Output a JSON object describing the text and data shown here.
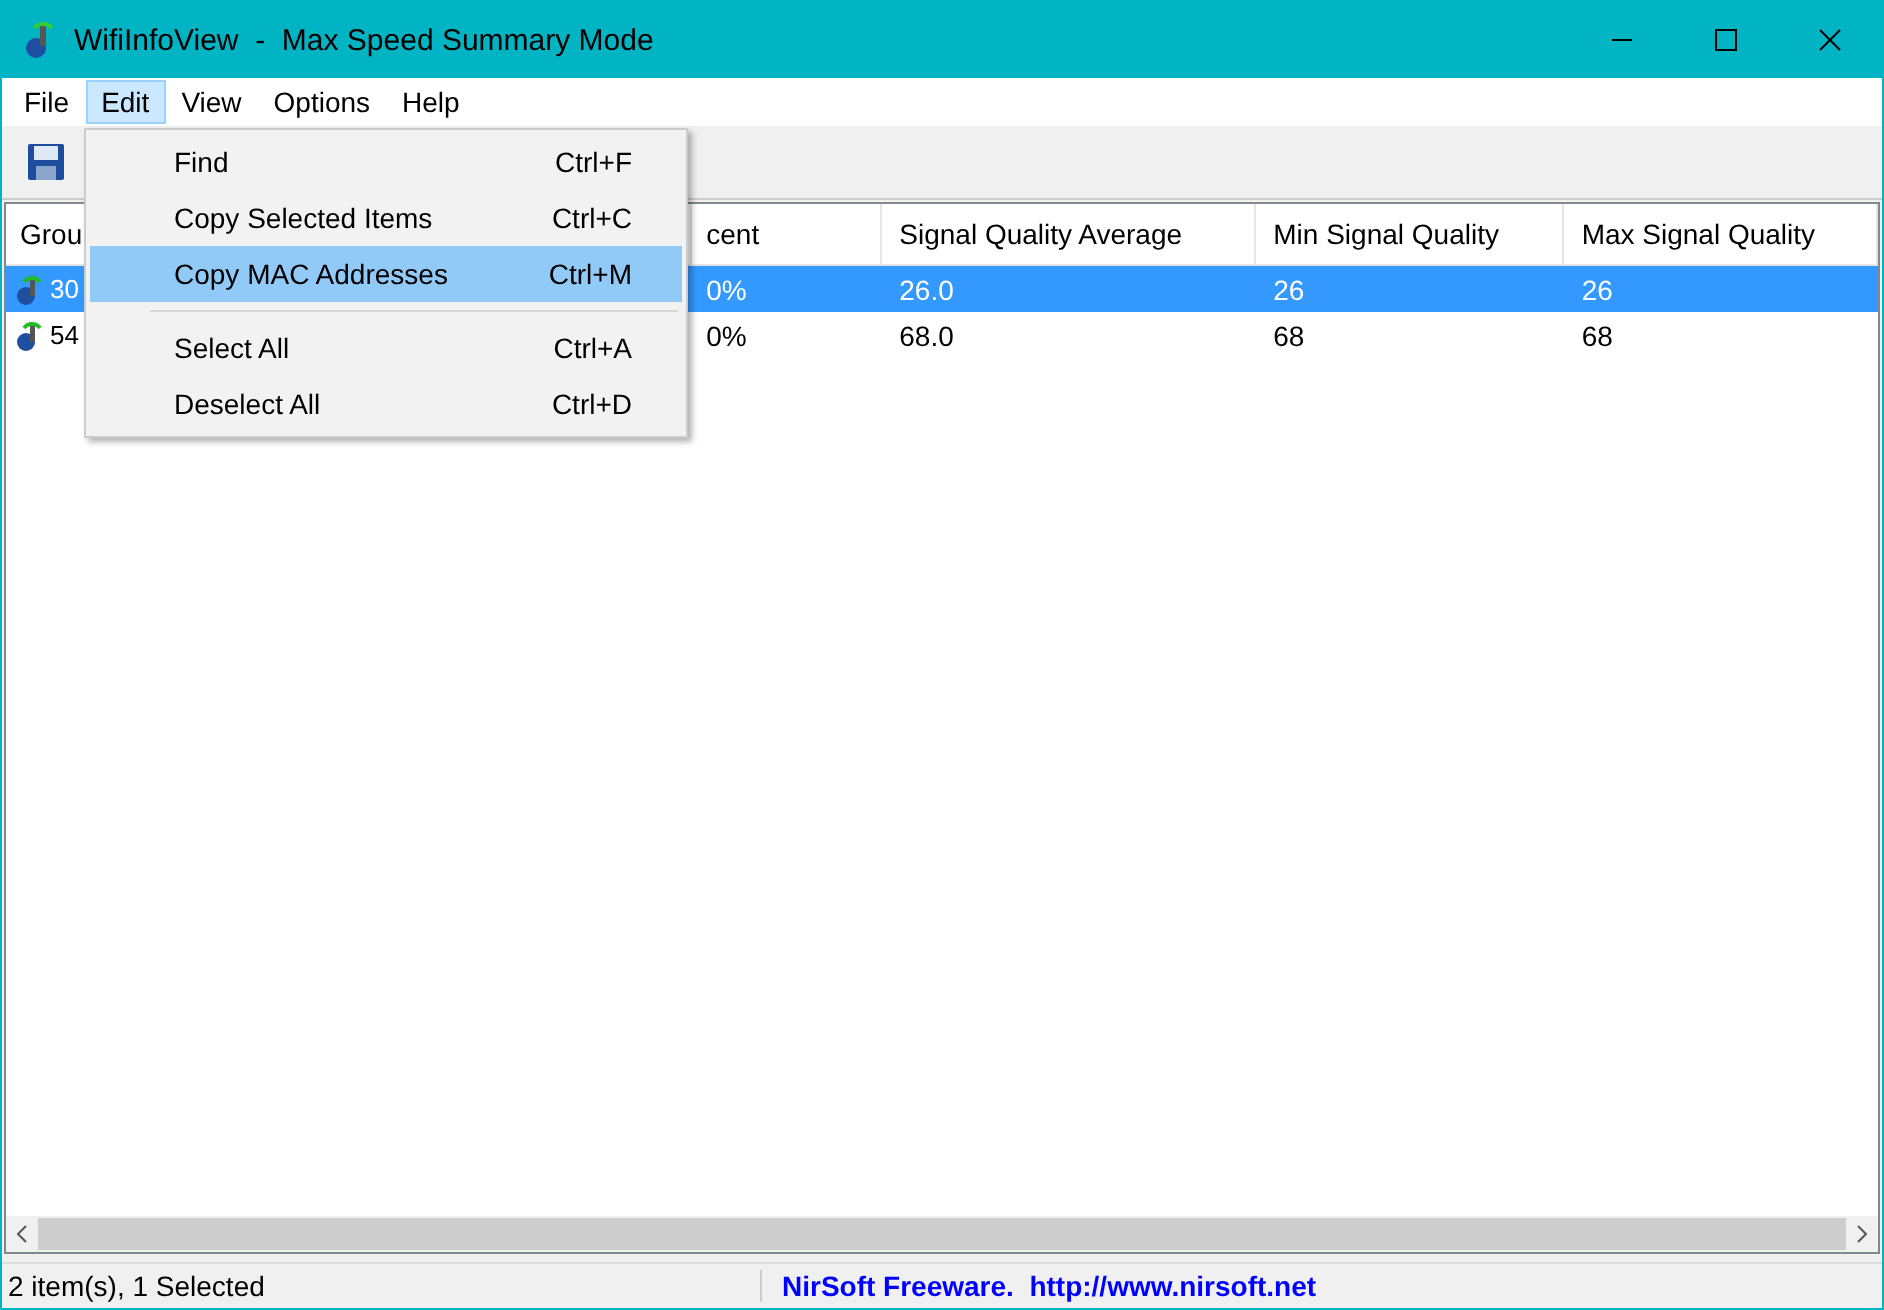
{
  "window": {
    "title": "WifiInfoView  -  Max Speed Summary Mode"
  },
  "menu_bar": [
    {
      "label": "File",
      "selected": false
    },
    {
      "label": "Edit",
      "selected": true
    },
    {
      "label": "View",
      "selected": false
    },
    {
      "label": "Options",
      "selected": false
    },
    {
      "label": "Help",
      "selected": false
    }
  ],
  "table": {
    "columns": [
      "Grou",
      "cent",
      "Signal Quality Average",
      "Min Signal Quality",
      "Max Signal Quality"
    ],
    "rows": [
      {
        "selected": true,
        "cells": [
          "30",
          "0%",
          "26.0",
          "26",
          "26"
        ]
      },
      {
        "selected": false,
        "cells": [
          "54",
          "0%",
          "68.0",
          "68",
          "68"
        ]
      }
    ]
  },
  "edit_menu": [
    {
      "kind": "item",
      "label": "Find",
      "shortcut": "Ctrl+F",
      "selected": false
    },
    {
      "kind": "item",
      "label": "Copy Selected Items",
      "shortcut": "Ctrl+C",
      "selected": false
    },
    {
      "kind": "item",
      "label": "Copy MAC Addresses",
      "shortcut": "Ctrl+M",
      "selected": true
    },
    {
      "kind": "separator"
    },
    {
      "kind": "item",
      "label": "Select All",
      "shortcut": "Ctrl+A",
      "selected": false
    },
    {
      "kind": "item",
      "label": "Deselect All",
      "shortcut": "Ctrl+D",
      "selected": false
    }
  ],
  "status_bar": {
    "items_text": "2 item(s), 1 Selected",
    "credit": "NirSoft Freeware.  http://www.nirsoft.net"
  }
}
